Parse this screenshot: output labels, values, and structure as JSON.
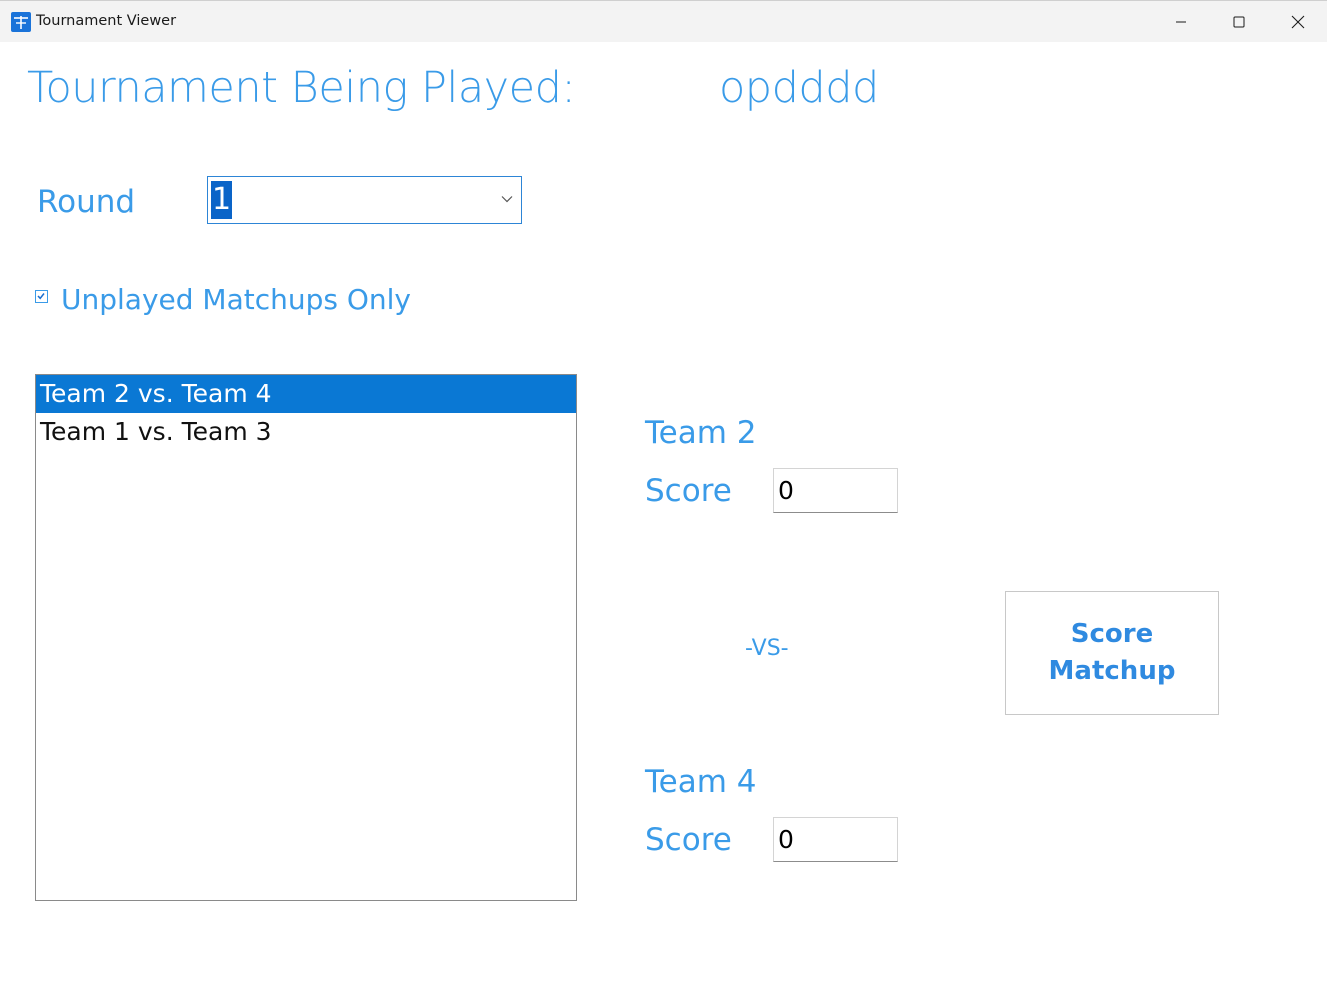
{
  "window": {
    "title": "Tournament Viewer"
  },
  "header": {
    "label": "Tournament Being Played:",
    "tournament_name": "opdddd"
  },
  "round": {
    "label": "Round",
    "selected_value": "1"
  },
  "filter": {
    "label": "Unplayed Matchups Only",
    "checked": true
  },
  "matchups": [
    {
      "label": "Team 2 vs. Team 4",
      "selected": true
    },
    {
      "label": "Team 1 vs. Team 3",
      "selected": false
    }
  ],
  "team_one": {
    "name": "Team 2",
    "score_label": "Score",
    "score_value": "0"
  },
  "team_two": {
    "name": "Team 4",
    "score_label": "Score",
    "score_value": "0"
  },
  "versus_label": "-VS-",
  "score_button": {
    "label": "Score Matchup"
  },
  "colors": {
    "accent": "#3a9be8",
    "selection": "#0a78d4"
  }
}
